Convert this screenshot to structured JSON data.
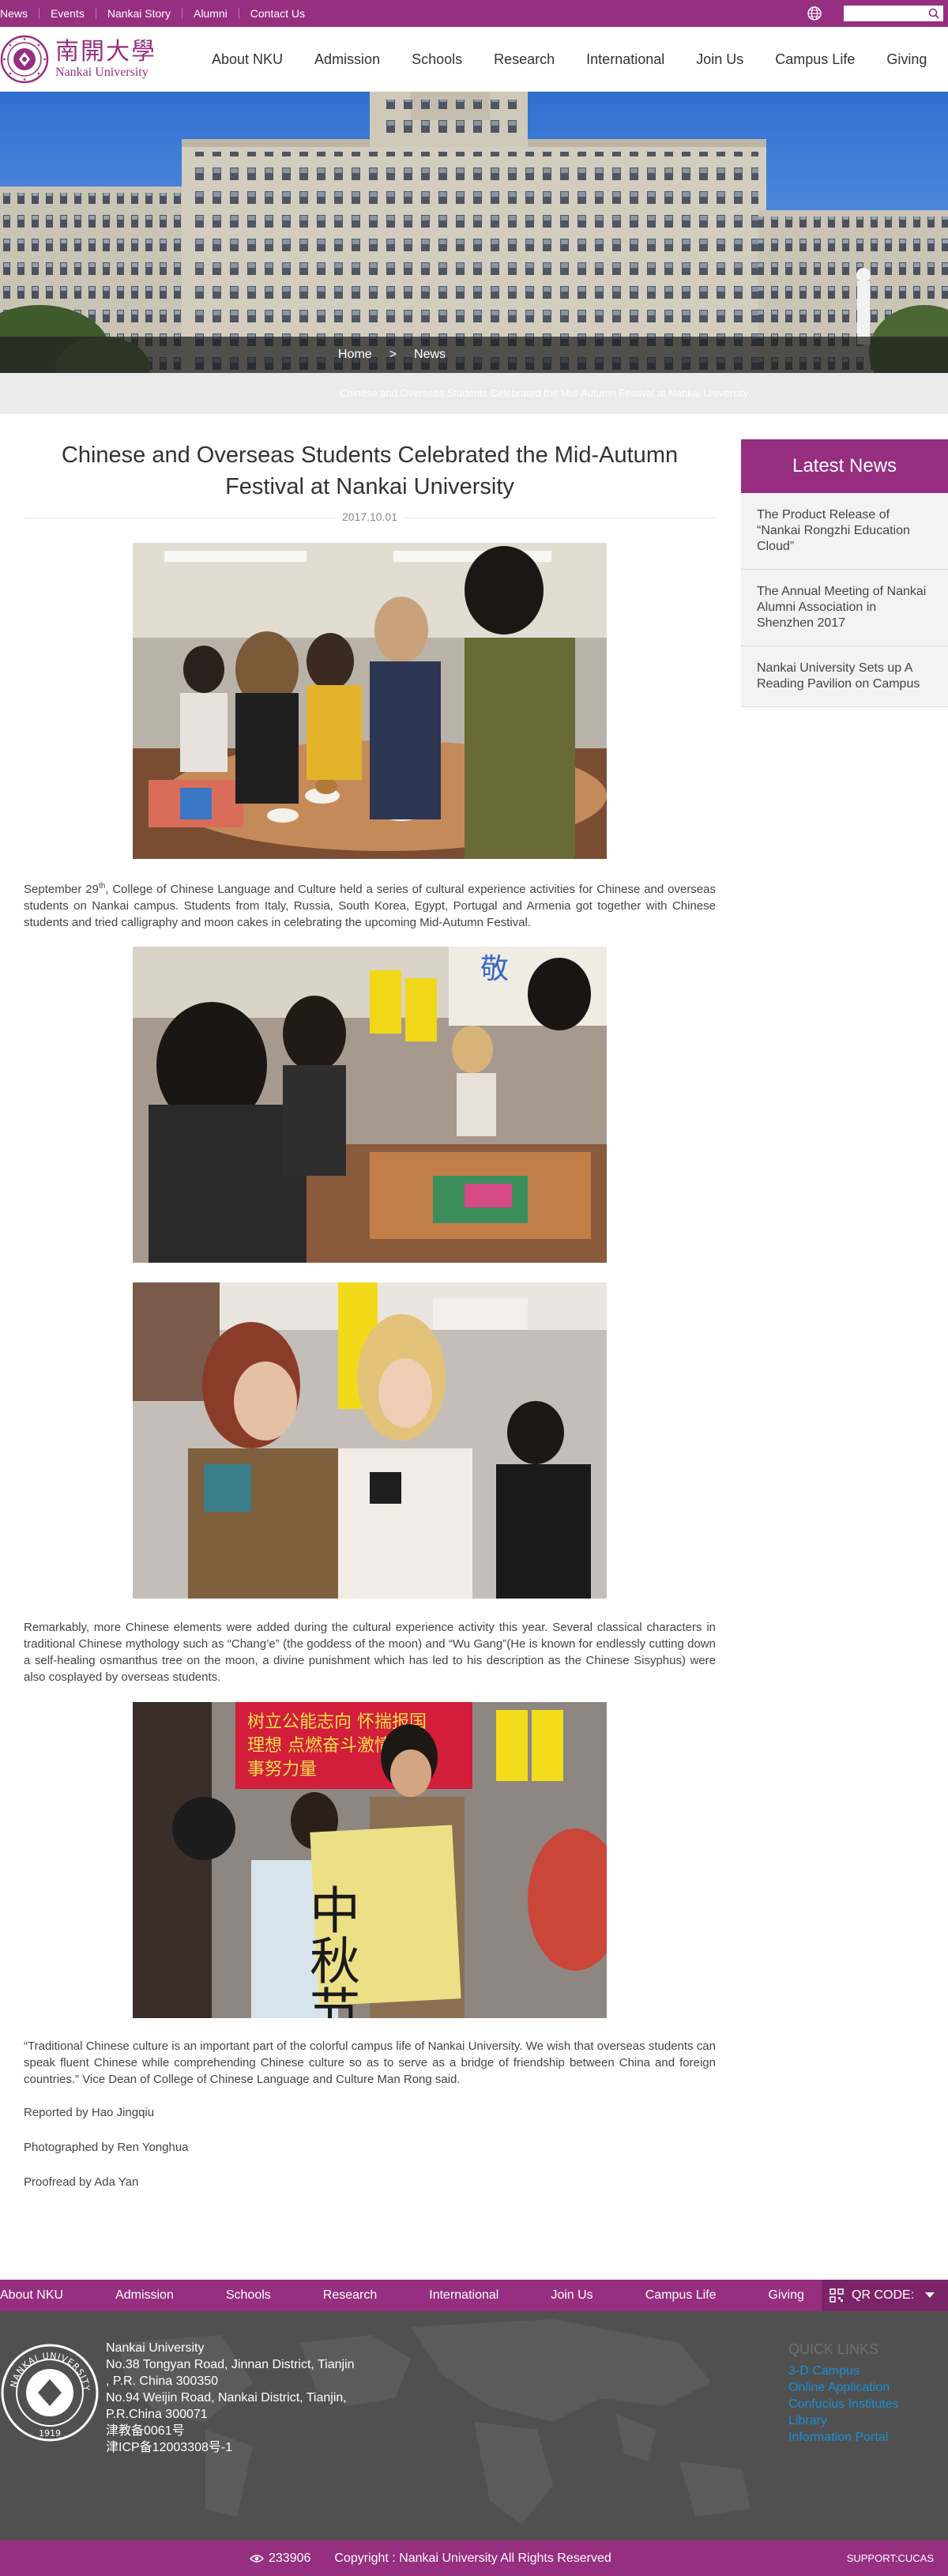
{
  "topbar": {
    "links": [
      "News",
      "Events",
      "Nankai Story",
      "Alumni",
      "Contact Us"
    ],
    "search_placeholder": ""
  },
  "logo": {
    "chinese": "南開大學",
    "english": "Nankai University"
  },
  "nav": [
    "About NKU",
    "Admission",
    "Schools",
    "Research",
    "International",
    "Join Us",
    "Campus Life",
    "Giving"
  ],
  "breadcrumb": {
    "home": "Home",
    "separator": ">",
    "current": "News"
  },
  "banner": {
    "subtitle": "Chinese and Overseas Students Celebrated the Mid-Autumn Festival at Nankai University"
  },
  "article": {
    "title": "Chinese and Overseas Students Celebrated the Mid-Autumn Festival at Nankai University",
    "date": "2017.10.01",
    "p1_pre": "September 29",
    "p1_sup": "th",
    "p1_post": ", College of Chinese Language and Culture held a series of cultural experience activities for Chinese and overseas students on Nankai campus. Students from Italy, Russia, South Korea, Egypt, Portugal and Armenia got together with Chinese students and tried calligraphy and moon cakes in celebrating the upcoming Mid-Autumn Festival.",
    "p2": "Remarkably, more Chinese elements were added during the cultural experience activity this year. Several classical characters in traditional Chinese mythology such as “Chang’e” (the goddess of the moon) and “Wu Gang”(He is known for endlessly cutting down a self-healing osmanthus  tree on the moon, a divine punishment which has led to his description as the Chinese Sisyphus) were also cosplayed by overseas students.",
    "p3": "“Traditional Chinese culture is an important part of the colorful campus life of Nankai University. We wish that overseas students can speak fluent Chinese while comprehending Chinese culture so as to serve as a bridge of friendship between China and foreign countries.” Vice Dean of College of Chinese Language and Culture Man Rong said.",
    "reported": "Reported by Hao Jingqiu",
    "photographed": "Photographed by Ren Yonghua",
    "proofread": "Proofread by Ada Yan",
    "photo4_banner1": "树立公能志向 怀揣报国",
    "photo4_banner2": "理想 点燃奋斗激情",
    "photo4_banner3": "事努力量",
    "photo4_scroll": "中秋节",
    "photo2_sign": "敬"
  },
  "sidebar": {
    "title": "Latest News",
    "items": [
      "The Product Release of “Nankai Rongzhi Education Cloud”",
      "The Annual Meeting of Nankai Alumni Association in Shenzhen 2017",
      "Nankai University Sets up A Reading Pavilion on Campus"
    ]
  },
  "footer_nav": {
    "links": [
      "About NKU",
      "Admission",
      "Schools",
      "Research",
      "International",
      "Join Us",
      "Campus Life",
      "Giving"
    ],
    "qr_label": "QR CODE:"
  },
  "footer": {
    "seal_text": "NANKAI UNIVERSITY",
    "seal_year": "1919",
    "address": [
      "Nankai University",
      "No.38 Tongyan Road, Jinnan District, Tianjin",
      ", P.R. China 300350",
      "No.94 Weijin Road,  Nankai District, Tianjin,",
      "P.R.China  300071",
      "津教备0061号",
      "津ICP备12003308号-1"
    ],
    "quick_links_title": "QUICK LINKS",
    "quick_links": [
      "3-D Campus",
      "Online Application",
      "Confucius Institutes",
      "Library",
      "Information Portal"
    ]
  },
  "bottom": {
    "visits": "233906",
    "copyright": "Copyright : Nankai University All Rights Reserved",
    "partner": "SUPPORT:CUCAS"
  },
  "colors": {
    "brand": "#962f80",
    "brand_dark": "#7c2468",
    "footer_bg": "#505050",
    "link_blue": "#1b8fd0"
  }
}
